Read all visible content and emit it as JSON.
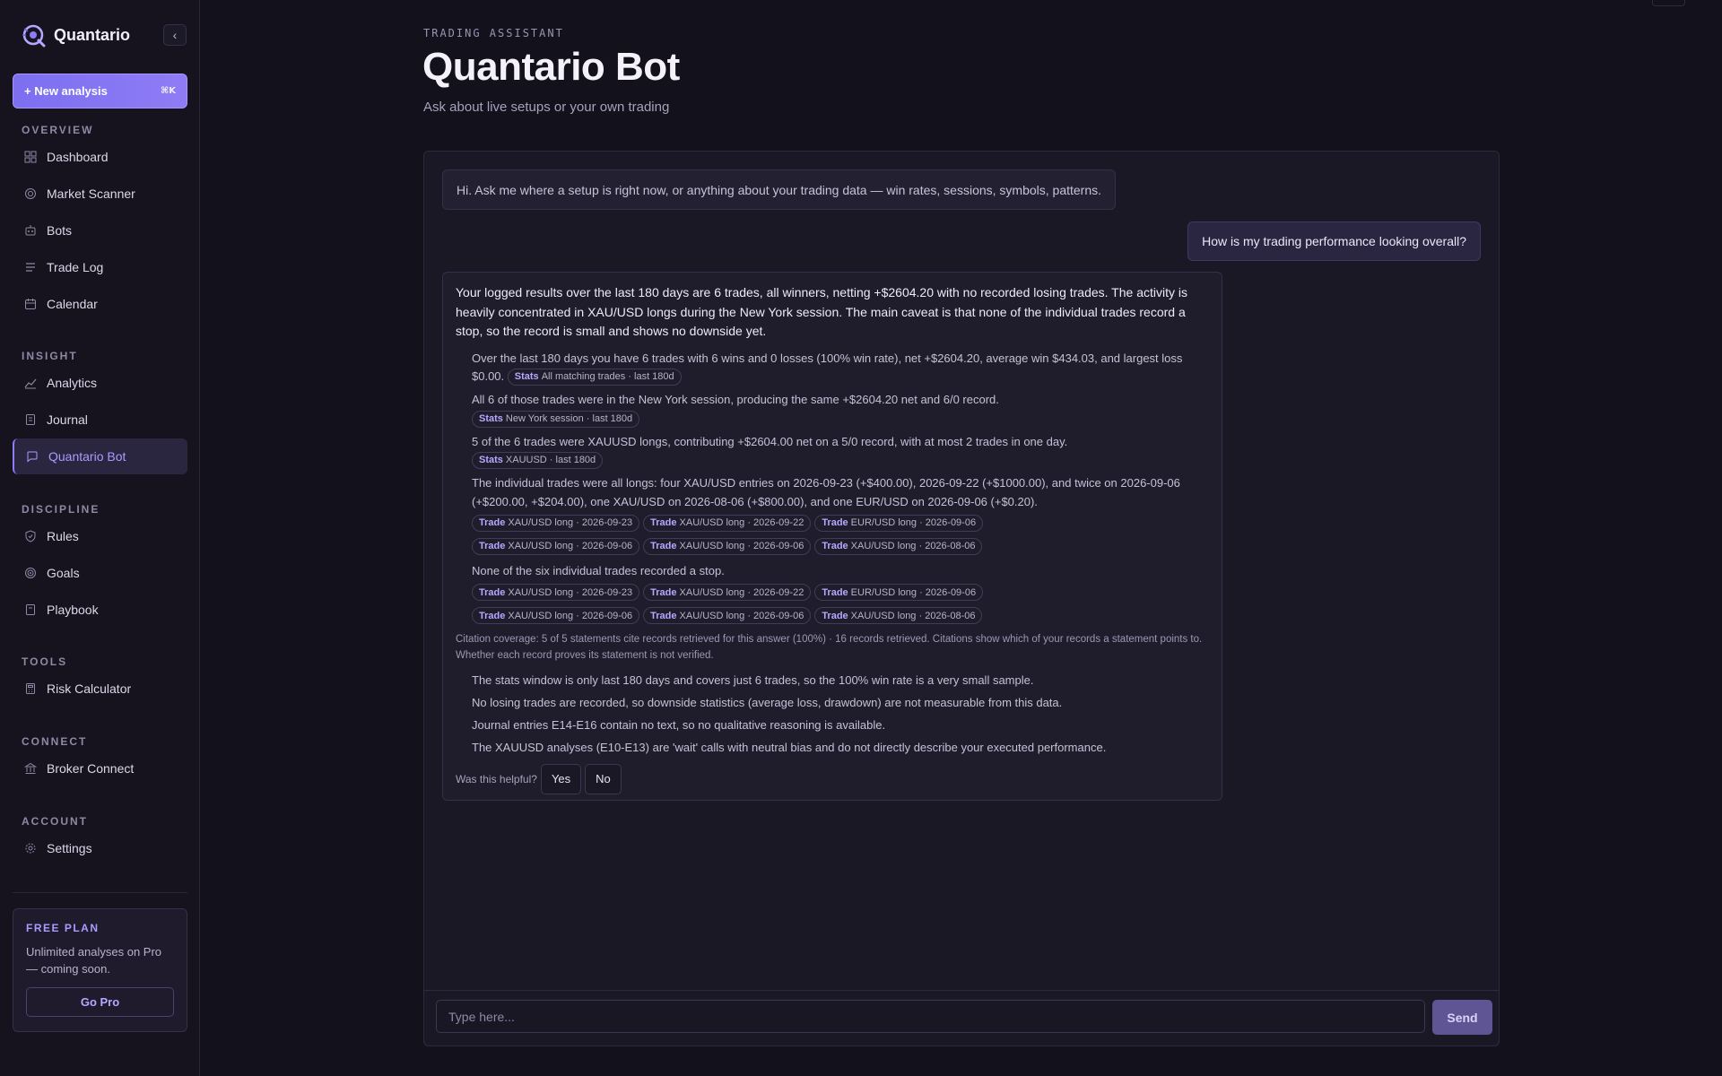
{
  "brand": {
    "name": "Quantario",
    "logo_icon": "quantario-logo-icon"
  },
  "sidebar": {
    "new_analysis_label": "+ New analysis",
    "new_analysis_shortcut": "⌘K",
    "sections": [
      {
        "title": "OVERVIEW",
        "items": [
          {
            "label": "Dashboard",
            "icon": "grid-icon"
          },
          {
            "label": "Market Scanner",
            "icon": "radar-icon"
          },
          {
            "label": "Bots",
            "icon": "robot-icon"
          },
          {
            "label": "Trade Log",
            "icon": "list-icon"
          },
          {
            "label": "Calendar",
            "icon": "calendar-icon"
          }
        ]
      },
      {
        "title": "INSIGHT",
        "items": [
          {
            "label": "Analytics",
            "icon": "line-chart-icon"
          },
          {
            "label": "Journal",
            "icon": "notebook-icon"
          },
          {
            "label": "Quantario Bot",
            "icon": "chat-bubble-icon",
            "active": true
          }
        ]
      },
      {
        "title": "DISCIPLINE",
        "items": [
          {
            "label": "Rules",
            "icon": "shield-icon"
          },
          {
            "label": "Goals",
            "icon": "target-icon"
          },
          {
            "label": "Playbook",
            "icon": "book-icon"
          }
        ]
      },
      {
        "title": "TOOLS",
        "items": [
          {
            "label": "Risk Calculator",
            "icon": "calculator-icon"
          }
        ]
      },
      {
        "title": "CONNECT",
        "items": [
          {
            "label": "Broker Connect",
            "icon": "bank-icon"
          }
        ]
      },
      {
        "title": "ACCOUNT",
        "items": [
          {
            "label": "Settings",
            "icon": "gear-icon"
          }
        ]
      }
    ],
    "plan": {
      "title": "FREE PLAN",
      "description": "Unlimited analyses on Pro — coming soon.",
      "cta": "Go Pro"
    }
  },
  "header": {
    "eyebrow": "TRADING ASSISTANT",
    "title": "Quantario Bot",
    "subtitle": "Ask about live setups or your own trading"
  },
  "chat": {
    "greeting": "Hi. Ask me where a setup is right now, or anything about your trading data — win rates, sessions, symbols, patterns.",
    "user_message": "How is my trading performance looking overall?",
    "answer": {
      "summary": "Your logged results over the last 180 days are 6 trades, all winners, netting +$2604.20 with no recorded losing trades. The activity is heavily concentrated in XAU/USD longs during the New York session. The main caveat is that none of the individual trades record a stop, so the record is small and shows no downside yet.",
      "statements": [
        {
          "text": "Over the last 180 days you have 6 trades with 6 wins and 0 losses (100% win rate), net +$2604.20, average win $434.03, and largest loss $0.00.",
          "citations": [
            {
              "kind": "Stats",
              "label": "All matching trades · last 180d"
            }
          ]
        },
        {
          "text": "All 6 of those trades were in the New York session, producing the same +$2604.20 net and 6/0 record.",
          "citations": [
            {
              "kind": "Stats",
              "label": "New York session · last 180d"
            }
          ]
        },
        {
          "text": "5 of the 6 trades were XAUUSD longs, contributing +$2604.00 net on a 5/0 record, with at most 2 trades in one day.",
          "citations": [
            {
              "kind": "Stats",
              "label": "XAUUSD · last 180d"
            }
          ]
        },
        {
          "text": "The individual trades were all longs: four XAU/USD entries on 2026-09-23 (+$400.00), 2026-09-22 (+$1000.00), and twice on 2026-09-06 (+$200.00, +$204.00), one XAU/USD on 2026-08-06 (+$800.00), and one EUR/USD on 2026-09-06 (+$0.20).",
          "citations": [
            {
              "kind": "Trade",
              "label": "XAU/USD long · 2026-09-23"
            },
            {
              "kind": "Trade",
              "label": "XAU/USD long · 2026-09-22"
            },
            {
              "kind": "Trade",
              "label": "EUR/USD long · 2026-09-06"
            },
            {
              "kind": "Trade",
              "label": "XAU/USD long · 2026-09-06"
            },
            {
              "kind": "Trade",
              "label": "XAU/USD long · 2026-09-06"
            },
            {
              "kind": "Trade",
              "label": "XAU/USD long · 2026-08-06"
            }
          ]
        },
        {
          "text": "None of the six individual trades recorded a stop.",
          "citations": [
            {
              "kind": "Trade",
              "label": "XAU/USD long · 2026-09-23"
            },
            {
              "kind": "Trade",
              "label": "XAU/USD long · 2026-09-22"
            },
            {
              "kind": "Trade",
              "label": "EUR/USD long · 2026-09-06"
            },
            {
              "kind": "Trade",
              "label": "XAU/USD long · 2026-09-06"
            },
            {
              "kind": "Trade",
              "label": "XAU/USD long · 2026-09-06"
            },
            {
              "kind": "Trade",
              "label": "XAU/USD long · 2026-08-06"
            }
          ]
        }
      ],
      "coverage": "Citation coverage: 5 of 5 statements cite records retrieved for this answer (100%) · 16 records retrieved. Citations show which of your records a statement points to. Whether each record proves its statement is not verified.",
      "caveats": [
        "The stats window is only last 180 days and covers just 6 trades, so the 100% win rate is a very small sample.",
        "No losing trades are recorded, so downside statistics (average loss, drawdown) are not measurable from this data.",
        "Journal entries E14-E16 contain no text, so no qualitative reasoning is available.",
        "The XAUUSD analyses (E10-E13) are 'wait' calls with neutral bias and do not directly describe your executed performance."
      ],
      "feedback": {
        "prompt": "Was this helpful?",
        "yes": "Yes",
        "no": "No"
      }
    },
    "input": {
      "placeholder": "Type here...",
      "value": ""
    },
    "send_label": "Send"
  },
  "colors": {
    "accent": "#8c7cf6",
    "background": "#13111c",
    "panel": "#1b1826"
  }
}
